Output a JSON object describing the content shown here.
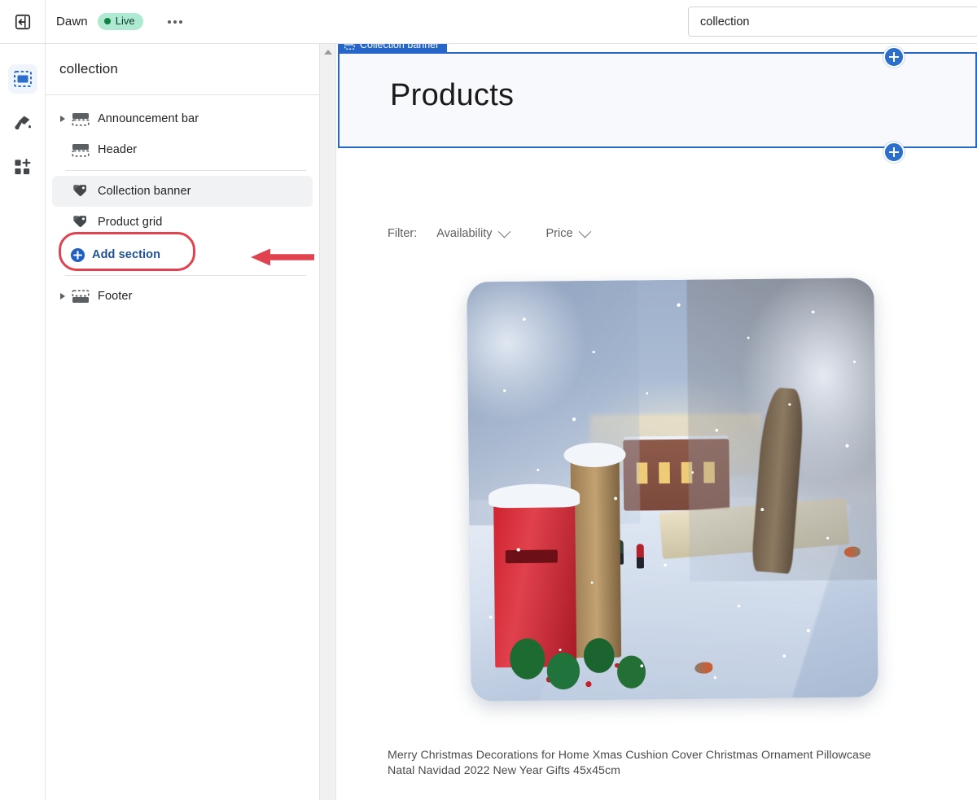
{
  "topbar": {
    "exit_icon": "exit-to-app-icon",
    "theme_name": "Dawn",
    "status_badge": "Live",
    "more_menu": "…",
    "page_picker_value": "collection"
  },
  "rail": {
    "items": [
      {
        "icon": "sections-icon",
        "name": "sections",
        "active": true
      },
      {
        "icon": "paint-brush-icon",
        "name": "theme-settings",
        "active": false
      },
      {
        "icon": "app-blocks-icon",
        "name": "app-embeds",
        "active": false
      }
    ]
  },
  "sidebar": {
    "title": "collection",
    "sections": [
      {
        "label": "Announcement bar",
        "icon": "announcement-bar-icon",
        "caret": true,
        "selected": false
      },
      {
        "label": "Header",
        "icon": "header-icon",
        "caret": false,
        "selected": false
      },
      {
        "label": "Collection banner",
        "icon": "tags-icon",
        "caret": false,
        "selected": true
      },
      {
        "label": "Product grid",
        "icon": "tags-icon",
        "caret": false,
        "selected": false
      }
    ],
    "add_section": {
      "label": "Add section",
      "icon": "circle-plus-icon"
    },
    "footer": {
      "label": "Footer",
      "icon": "footer-icon",
      "caret": true
    }
  },
  "annotation": {
    "highlight_color": "#e0434f",
    "arrow_color": "#e0434f",
    "target": "Add section"
  },
  "preview": {
    "section_label": "Collection banner",
    "banner_title": "Products",
    "add_block_top": "+",
    "add_block_bottom": "+",
    "filters": {
      "label": "Filter:",
      "options": [
        "Availability",
        "Price"
      ]
    },
    "product": {
      "title": "Merry Christmas Decorations for Home Xmas Cushion Cover Christmas Ornament Pillowcase Natal Navidad 2022 New Year Gifts 45x45cm",
      "image_alt": "christmas-cushion-snow-village-scene"
    }
  },
  "colors": {
    "accent_blue": "#2c6ecb",
    "selection_blue": "#2566c8",
    "live_green_bg": "#aee9d1",
    "live_green_dot": "#108043",
    "annotation_red": "#e0434f",
    "link_blue": "#1f5199"
  }
}
